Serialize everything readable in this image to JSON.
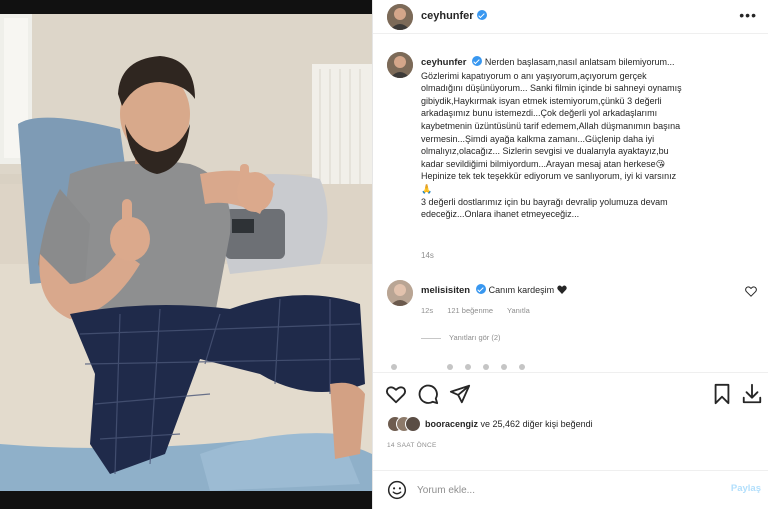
{
  "post": {
    "username": "ceyhunfer",
    "caption_lines": [
      "Nerden başlasam,nasıl anlatsam bilemiyorum...",
      "Gözlerimi kapatıyorum o anı yaşıyorum,açıyorum gerçek",
      "olmadığını düşünüyorum... Sanki filmin içinde bi sahneyi oynamış",
      "gibiydik,Haykırmak isyan etmek istemiyorum,çünkü 3 değerli",
      "arkadaşımız bunu istemezdi...Çok değerli yol arkadaşlarımı",
      "kaybetmenin üzüntüsünü tarif edemem,Allah düşmanımın başına",
      "vermesin...Şimdi ayağa kalkma zamanı...Güçlenip daha iyi",
      "olmalıyız,olacağız... Sizlerin sevgisi ve dualarıyla ayaktayız,bu",
      "kadar sevildiğimi bilmiyordum...Arayan mesaj atan herkese😘",
      "Hepinize tek tek teşekkür ediyorum ve sanlıyorum, iyi ki varsınız",
      "🙏",
      "3 değerli dostlarımız için bu bayrağı devralip yolumuza devam",
      "edeceğiz...Onlara ihanet etmeyeceğiz..."
    ],
    "caption_time": "14s",
    "likers_text_user": "booracengiz",
    "likers_text_rest": "ve 25,462 diğer kişi beğendi",
    "time_ago": "14 SAAT ÖNCE"
  },
  "comment": {
    "username": "melisisiten",
    "text": "Canım kardeşim",
    "time": "12s",
    "likes": "121 beğenme",
    "reply": "Yanıtla",
    "view_replies": "Yanıtları gör (2)"
  },
  "input": {
    "placeholder": "Yorum ekle...",
    "post_label": "Paylaş"
  },
  "icons": {
    "more": "more-options-icon",
    "like": "heart-icon",
    "comment": "comment-icon",
    "share": "share-icon",
    "save": "bookmark-icon",
    "download": "download-icon",
    "emoji": "emoji-icon"
  },
  "colors": {
    "verified": "#3897f0",
    "post_button": "#b2dffc",
    "secondary_text": "#8e8e8e"
  }
}
